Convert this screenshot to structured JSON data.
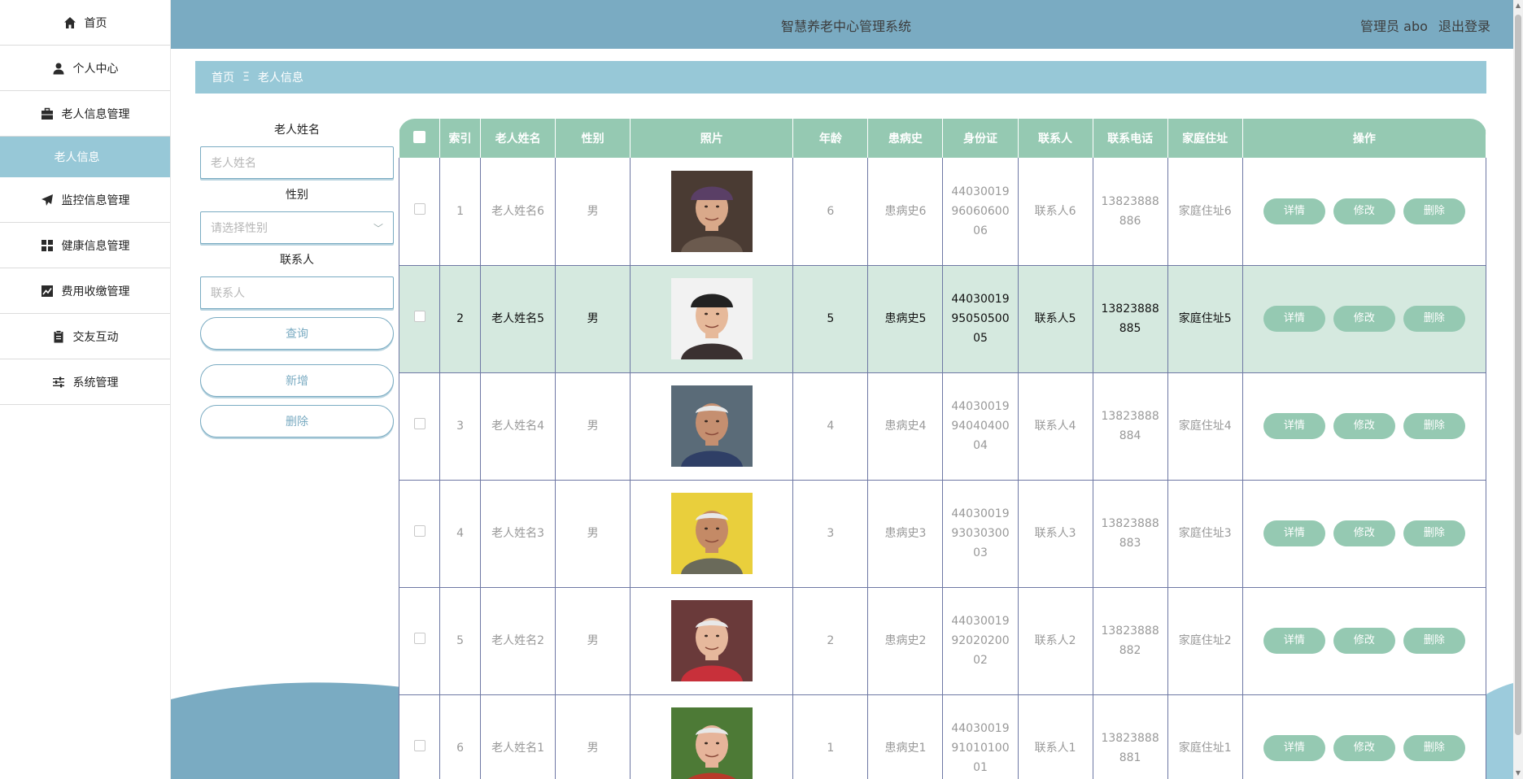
{
  "header": {
    "title": "智慧养老中心管理系统",
    "user": "管理员 abo",
    "logout": "退出登录"
  },
  "sidebar": {
    "items": [
      {
        "label": "首页",
        "icon": "home-icon"
      },
      {
        "label": "个人中心",
        "icon": "user-icon"
      },
      {
        "label": "老人信息管理",
        "icon": "briefcase-icon"
      },
      {
        "label": "老人信息",
        "icon": ""
      },
      {
        "label": "监控信息管理",
        "icon": "paper-plane-icon"
      },
      {
        "label": "健康信息管理",
        "icon": "grid-icon"
      },
      {
        "label": "费用收缴管理",
        "icon": "chart-icon"
      },
      {
        "label": "交友互动",
        "icon": "clipboard-icon"
      },
      {
        "label": "系统管理",
        "icon": "sliders-icon"
      }
    ]
  },
  "breadcrumb": {
    "home": "首页",
    "sep": "Ξ",
    "current": "老人信息"
  },
  "search": {
    "name_label": "老人姓名",
    "name_placeholder": "老人姓名",
    "gender_label": "性别",
    "gender_placeholder": "请选择性别",
    "contact_label": "联系人",
    "contact_placeholder": "联系人",
    "query": "查询",
    "add": "新增",
    "delete": "删除"
  },
  "table": {
    "headers": [
      "索引",
      "老人姓名",
      "性别",
      "照片",
      "年龄",
      "患病史",
      "身份证",
      "联系人",
      "联系电话",
      "家庭住址",
      "操作"
    ],
    "rows": [
      {
        "index": "1",
        "name": "老人姓名6",
        "gender": "男",
        "age": "6",
        "history": "患病史6",
        "id": "440300199606060006",
        "contact": "联系人6",
        "phone": "13823888886",
        "address": "家庭住址6"
      },
      {
        "index": "2",
        "name": "老人姓名5",
        "gender": "男",
        "age": "5",
        "history": "患病史5",
        "id": "440300199505050005",
        "contact": "联系人5",
        "phone": "13823888885",
        "address": "家庭住址5"
      },
      {
        "index": "3",
        "name": "老人姓名4",
        "gender": "男",
        "age": "4",
        "history": "患病史4",
        "id": "440300199404040004",
        "contact": "联系人4",
        "phone": "13823888884",
        "address": "家庭住址4"
      },
      {
        "index": "4",
        "name": "老人姓名3",
        "gender": "男",
        "age": "3",
        "history": "患病史3",
        "id": "440300199303030003",
        "contact": "联系人3",
        "phone": "13823888883",
        "address": "家庭住址3"
      },
      {
        "index": "5",
        "name": "老人姓名2",
        "gender": "男",
        "age": "2",
        "history": "患病史2",
        "id": "440300199202020002",
        "contact": "联系人2",
        "phone": "13823888882",
        "address": "家庭住址2"
      },
      {
        "index": "6",
        "name": "老人姓名1",
        "gender": "男",
        "age": "1",
        "history": "患病史1",
        "id": "440300199101010001",
        "contact": "联系人1",
        "phone": "13823888881",
        "address": "家庭住址1"
      }
    ],
    "actions": {
      "detail": "详情",
      "edit": "修改",
      "delete": "删除"
    }
  },
  "colors": {
    "header": "#7aabc2",
    "accent": "#97c8d7",
    "table_head": "#95c9b2",
    "highlight_row": "#d5e9df"
  }
}
